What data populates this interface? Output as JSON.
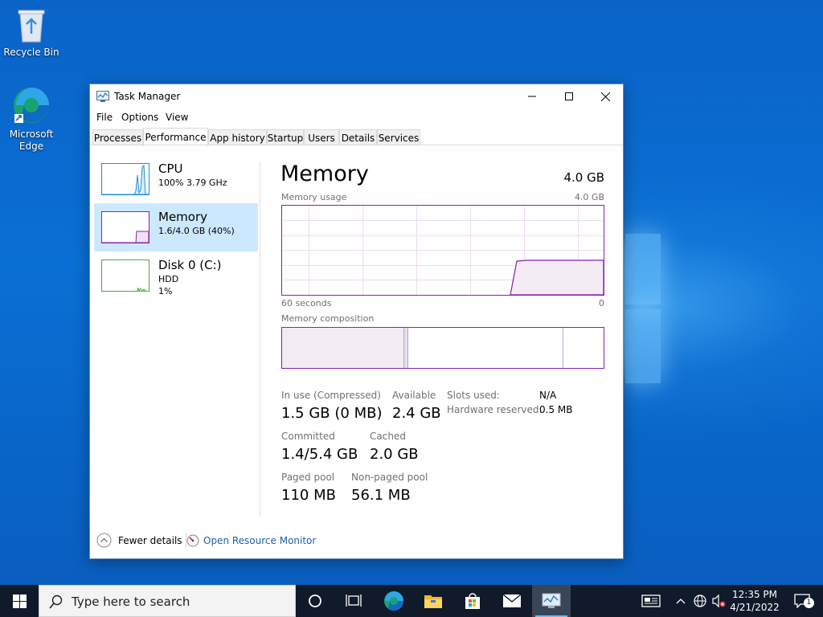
{
  "desktop": {
    "icons": [
      {
        "label": "Recycle Bin"
      },
      {
        "label": "Microsoft Edge"
      }
    ]
  },
  "window": {
    "title": "Task Manager",
    "menu": [
      "File",
      "Options",
      "View"
    ],
    "tabs": [
      "Processes",
      "Performance",
      "App history",
      "Startup",
      "Users",
      "Details",
      "Services"
    ],
    "active_tab": "Performance"
  },
  "sidebar": {
    "items": [
      {
        "title": "CPU",
        "line1": "100% 3.79 GHz",
        "line2": ""
      },
      {
        "title": "Memory",
        "line1": "1.6/4.0 GB (40%)",
        "line2": ""
      },
      {
        "title": "Disk 0 (C:)",
        "line1": "HDD",
        "line2": "1%"
      }
    ]
  },
  "memory": {
    "title": "Memory",
    "total": "4.0 GB",
    "usage_label": "Memory usage",
    "usage_max": "4.0 GB",
    "axis_left": "60 seconds",
    "axis_right": "0",
    "composition_label": "Memory composition",
    "usage_fraction_now": 0.4,
    "stats": {
      "in_use_label": "In use (Compressed)",
      "in_use_value": "1.5 GB (0 MB)",
      "available_label": "Available",
      "available_value": "2.4 GB",
      "committed_label": "Committed",
      "committed_value": "1.4/5.4 GB",
      "cached_label": "Cached",
      "cached_value": "2.0 GB",
      "paged_label": "Paged pool",
      "paged_value": "110 MB",
      "nonpaged_label": "Non-paged pool",
      "nonpaged_value": "56.1 MB",
      "slots_label": "Slots used:",
      "slots_value": "N/A",
      "hw_label": "Hardware reserved:",
      "hw_value": "0.5 MB"
    }
  },
  "footer": {
    "fewer_details": "Fewer details",
    "open_monitor": "Open Resource Monitor"
  },
  "taskbar": {
    "search_placeholder": "Type here to search",
    "time": "12:35 PM",
    "date": "4/21/2022",
    "notification_count": "1"
  },
  "colors": {
    "memory_accent": "#8b1fb0",
    "cpu_accent": "#1c8dd9",
    "disk_accent": "#4ca64c",
    "link": "#1a5fb4",
    "selected_bg": "#cce8ff"
  }
}
